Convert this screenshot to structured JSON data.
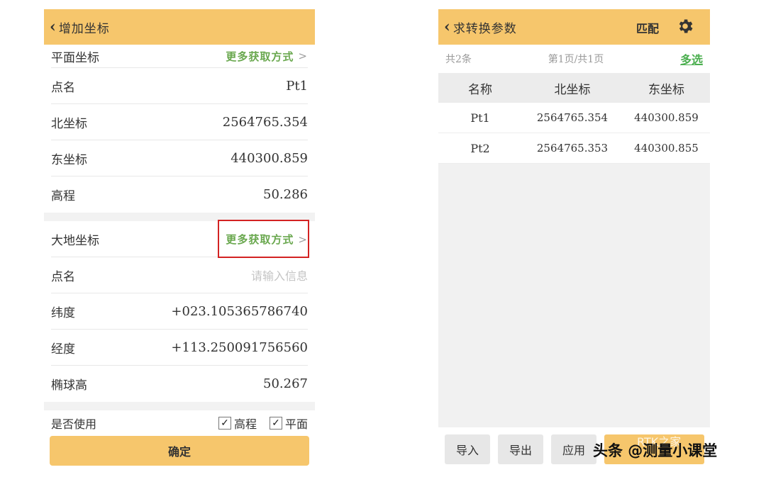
{
  "left": {
    "title": "增加坐标",
    "plane_section": {
      "label": "平面坐标",
      "more": "更多获取方式"
    },
    "plane_rows": [
      {
        "label": "点名",
        "value": "Pt1"
      },
      {
        "label": "北坐标",
        "value": "2564765.354"
      },
      {
        "label": "东坐标",
        "value": "440300.859"
      },
      {
        "label": "高程",
        "value": "50.286"
      }
    ],
    "geo_section": {
      "label": "大地坐标",
      "more": "更多获取方式"
    },
    "geo_point": {
      "label": "点名",
      "placeholder": "请输入信息"
    },
    "geo_rows": [
      {
        "label": "纬度",
        "value": "+023.105365786740"
      },
      {
        "label": "经度",
        "value": "+113.250091756560"
      },
      {
        "label": "椭球高",
        "value": "50.267"
      }
    ],
    "use": {
      "label": "是否使用",
      "opt1": "高程",
      "opt2": "平面",
      "check": "✓"
    },
    "confirm": "确定"
  },
  "right": {
    "title": "求转换参数",
    "match": "匹配",
    "count": "共2条",
    "page": "第1页/共1页",
    "multi": "多选",
    "headers": [
      "名称",
      "北坐标",
      "东坐标"
    ],
    "rows": [
      [
        "Pt1",
        "2564765.354",
        "440300.859"
      ],
      [
        "Pt2",
        "2564765.353",
        "440300.855"
      ]
    ],
    "buttons": [
      "导入",
      "导出",
      "应用"
    ]
  },
  "watermark": "头条 @测量小课堂",
  "watermark_faint": "RTK之家",
  "colors": {
    "accent": "#f6c66c",
    "link": "#6aa84f",
    "highlight": "#d32222"
  }
}
